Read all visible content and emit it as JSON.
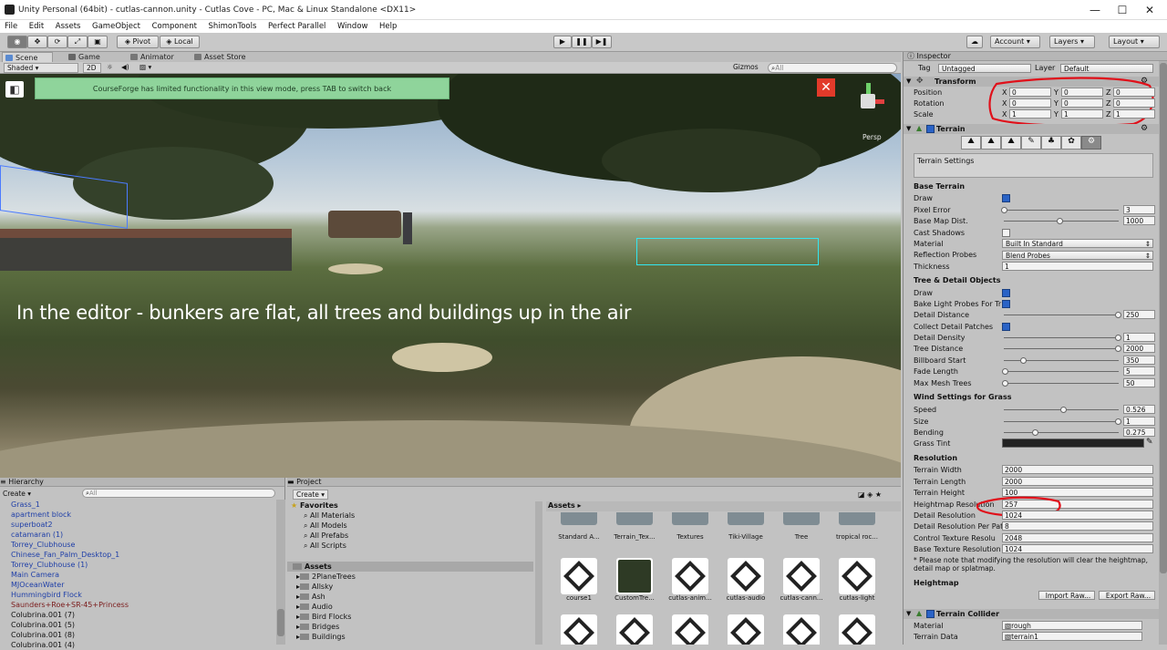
{
  "window": {
    "title": "Unity Personal (64bit) - cutlas-cannon.unity - Cutlas Cove - PC, Mac & Linux Standalone <DX11>",
    "minimize": "—",
    "maximize": "☐",
    "close": "✕"
  },
  "menu": [
    "File",
    "Edit",
    "Assets",
    "GameObject",
    "Component",
    "ShimonTools",
    "Perfect Parallel",
    "Window",
    "Help"
  ],
  "toolbar": {
    "pivot": "Pivot",
    "local": "Local",
    "account": "Account",
    "layers": "Layers",
    "layout": "Layout"
  },
  "scene_tabs": {
    "scene": "Scene",
    "game": "Game",
    "animator": "Animator",
    "asset_store": "Asset Store"
  },
  "scene_bar": {
    "shaded": "Shaded",
    "mode_2d": "2D",
    "gizmos": "Gizmos",
    "search_placeholder": "All",
    "persp": "Persp"
  },
  "viewport": {
    "notice": "CourseForge has limited functionality in this view mode, press TAB to switch back",
    "caption": "In the editor - bunkers are flat, all trees and buildings up in the air"
  },
  "hierarchy": {
    "title": "Hierarchy",
    "create": "Create",
    "search_placeholder": "All",
    "items": [
      {
        "label": "Grass_1",
        "color": "#1f3fa8"
      },
      {
        "label": "apartment block",
        "color": "#1f3fa8"
      },
      {
        "label": "superboat2",
        "color": "#1f3fa8"
      },
      {
        "label": "catamaran (1)",
        "color": "#1f3fa8"
      },
      {
        "label": "Torrey_Clubhouse",
        "color": "#1f3fa8"
      },
      {
        "label": "Chinese_Fan_Palm_Desktop_1",
        "color": "#1f3fa8"
      },
      {
        "label": "Torrey_Clubhouse (1)",
        "color": "#1f3fa8"
      },
      {
        "label": "Main Camera",
        "color": "#1f3fa8"
      },
      {
        "label": "MJOceanWater",
        "color": "#1f3fa8"
      },
      {
        "label": "Hummingbird Flock",
        "color": "#1f3fa8"
      },
      {
        "label": "Saunders+Roe+SR-45+Princess",
        "color": "#7a1a1a"
      },
      {
        "label": "Colubrina.001 (7)",
        "color": "#111111"
      },
      {
        "label": "Colubrina.001 (5)",
        "color": "#111111"
      },
      {
        "label": "Colubrina.001 (8)",
        "color": "#111111"
      },
      {
        "label": "Colubrina.001 (4)",
        "color": "#111111"
      }
    ]
  },
  "project": {
    "title": "Project",
    "create": "Create",
    "favorites": "Favorites",
    "fav_items": [
      "All Materials",
      "All Models",
      "All Prefabs",
      "All Scripts"
    ],
    "assets_root": "Assets",
    "folders": [
      "2PlaneTrees",
      "Allsky",
      "Ash",
      "Audio",
      "Bird Flocks",
      "Bridges",
      "Buildings"
    ],
    "breadcrumb": "Assets ▸",
    "row1": [
      "Standard A...",
      "Terrain_Tex...",
      "Textures",
      "Tiki-Village",
      "Tree",
      "tropical roc..."
    ],
    "row2": [
      "course1",
      "CustomTre...",
      "cutlas-anim...",
      "cutlas-audio",
      "cutlas-cann...",
      "cutlas-light"
    ]
  },
  "inspector": {
    "title": "Inspector",
    "tag_label": "Tag",
    "tag_value": "Untagged",
    "layer_label": "Layer",
    "layer_value": "Default",
    "transform": {
      "title": "Transform",
      "rows": [
        {
          "label": "Position",
          "x": "0",
          "y": "0",
          "z": "0"
        },
        {
          "label": "Rotation",
          "x": "0",
          "y": "0",
          "z": "0"
        },
        {
          "label": "Scale",
          "x": "1",
          "y": "1",
          "z": "1"
        }
      ]
    },
    "terrain_title": "Terrain",
    "terrain_settings": "Terrain Settings",
    "base_terrain": "Base Terrain",
    "draw": "Draw",
    "pixel_error": "Pixel Error",
    "pixel_error_val": "3",
    "base_map_dist": "Base Map Dist.",
    "base_map_dist_val": "1000",
    "cast_shadows": "Cast Shadows",
    "material": "Material",
    "material_val": "Built In Standard",
    "reflection_probes": "Reflection Probes",
    "reflection_probes_val": "Blend Probes",
    "thickness": "Thickness",
    "thickness_val": "1",
    "tree_detail": "Tree & Detail Objects",
    "bake_light": "Bake Light Probes For Tr",
    "detail_distance": "Detail Distance",
    "detail_distance_val": "250",
    "collect_detail": "Collect Detail Patches",
    "detail_density": "Detail Density",
    "detail_density_val": "1",
    "tree_distance": "Tree Distance",
    "tree_distance_val": "2000",
    "billboard_start": "Billboard Start",
    "billboard_start_val": "350",
    "fade_length": "Fade Length",
    "fade_length_val": "5",
    "max_mesh_trees": "Max Mesh Trees",
    "max_mesh_trees_val": "50",
    "wind_settings": "Wind Settings for Grass",
    "speed": "Speed",
    "speed_val": "0.526",
    "size": "Size",
    "size_val": "1",
    "bending": "Bending",
    "bending_val": "0.275",
    "grass_tint": "Grass Tint",
    "resolution": "Resolution",
    "terrain_width": "Terrain Width",
    "terrain_width_val": "2000",
    "terrain_length": "Terrain Length",
    "terrain_length_val": "2000",
    "terrain_height": "Terrain Height",
    "terrain_height_val": "100",
    "heightmap_res": "Heightmap Resolution",
    "heightmap_res_val": "257",
    "detail_res": "Detail Resolution",
    "detail_res_val": "1024",
    "detail_res_patch": "Detail Resolution Per Pat",
    "detail_res_patch_val": "8",
    "control_tex_res": "Control Texture Resolu",
    "control_tex_res_val": "2048",
    "base_tex_res": "Base Texture Resolution",
    "base_tex_res_val": "1024",
    "note": "* Please note that modifying the resolution will clear the heightmap, detail map or splatmap.",
    "heightmap": "Heightmap",
    "import_raw": "Import Raw...",
    "export_raw": "Export Raw...",
    "collider_title": "Terrain Collider",
    "collider_material": "Material",
    "collider_material_val": "rough",
    "terrain_data": "Terrain Data",
    "terrain_data_val": "terrain1"
  },
  "colors": {
    "annotation": "#e0101a",
    "accent": "#2a63c6"
  }
}
